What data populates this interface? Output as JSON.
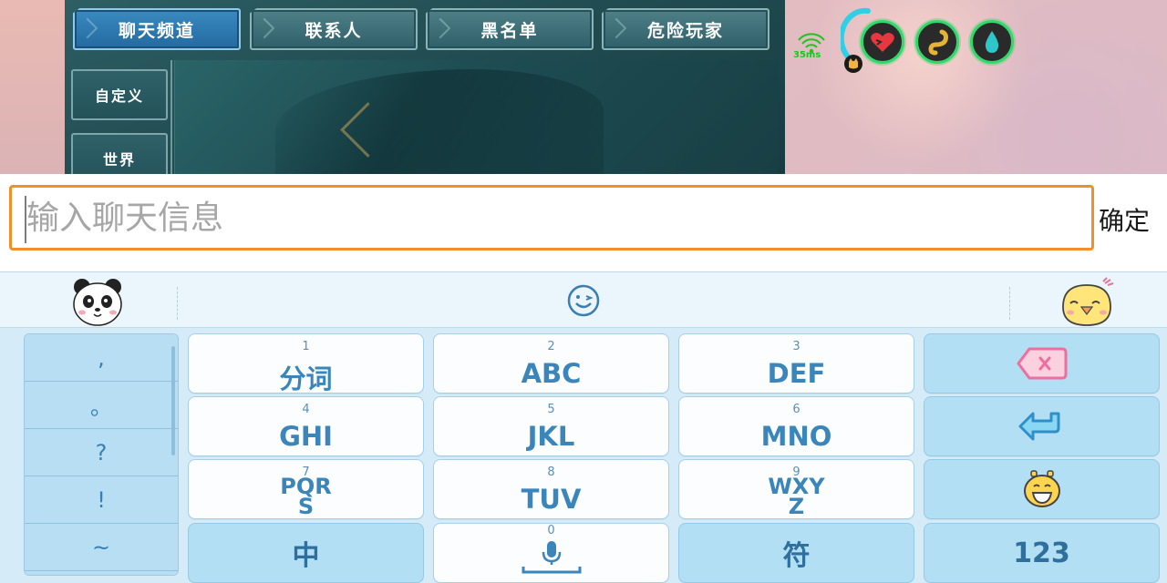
{
  "game": {
    "tabs": [
      {
        "label": "聊天频道",
        "active": true
      },
      {
        "label": "联系人",
        "active": false
      },
      {
        "label": "黑名单",
        "active": false
      },
      {
        "label": "危险玩家",
        "active": false
      }
    ],
    "channels": [
      {
        "label": "自定义"
      },
      {
        "label": "世界"
      }
    ],
    "hud": {
      "ping": "35ms",
      "gauges": [
        "heart-icon",
        "stomach-icon",
        "water-drop-icon"
      ]
    }
  },
  "chat_input": {
    "value": "",
    "placeholder": "输入聊天信息",
    "confirm_label": "确定"
  },
  "keyboard": {
    "strip": [
      "panda-emoji-icon",
      "smiley-icon",
      "chick-emoji-icon"
    ],
    "punctuation": [
      ",",
      "。",
      "?",
      "!",
      "~"
    ],
    "keys": [
      {
        "num": "1",
        "label": "分词"
      },
      {
        "num": "2",
        "label": "ABC"
      },
      {
        "num": "3",
        "label": "DEF"
      },
      {
        "num": "4",
        "label": "GHI"
      },
      {
        "num": "5",
        "label": "JKL"
      },
      {
        "num": "6",
        "label": "MNO"
      },
      {
        "num": "7",
        "label": "PQR\nS"
      },
      {
        "num": "8",
        "label": "TUV"
      },
      {
        "num": "9",
        "label": "WXY\nZ"
      }
    ],
    "bottom": {
      "lang_label": "中",
      "space_num": "0",
      "symbol_label": "符",
      "numeric_label": "123"
    },
    "colors": {
      "key_text": "#3a85ba",
      "key_bg": "#fbfdff",
      "func_bg": "#b3dff4",
      "input_border": "#f1902a",
      "tab_active": "#2a77ad"
    }
  }
}
